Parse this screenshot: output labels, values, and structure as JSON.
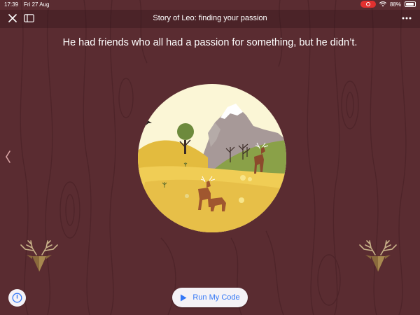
{
  "status_bar": {
    "time": "17:39",
    "date": "Fri 27 Aug",
    "battery": "88%",
    "battery_level": 0.88,
    "recording_color": "#e1302f"
  },
  "nav": {
    "title": "Story of Leo: finding your passion",
    "close_icon": "close-icon",
    "sidebar_icon": "sidebar-icon",
    "more_icon": "more-icon"
  },
  "page": {
    "narration": "He had friends who all had a passion for something, but he didn’t.",
    "background_color": "#5a2c31"
  },
  "controls": {
    "run_label": "Run My Code",
    "run_icon": "play-icon",
    "accent_color": "#3478f6",
    "info_icon": "timer-icon",
    "previous_icon": "deer-head-icon",
    "next_icon": "deer-head-icon",
    "edge_icon": "chevron-left-icon"
  }
}
